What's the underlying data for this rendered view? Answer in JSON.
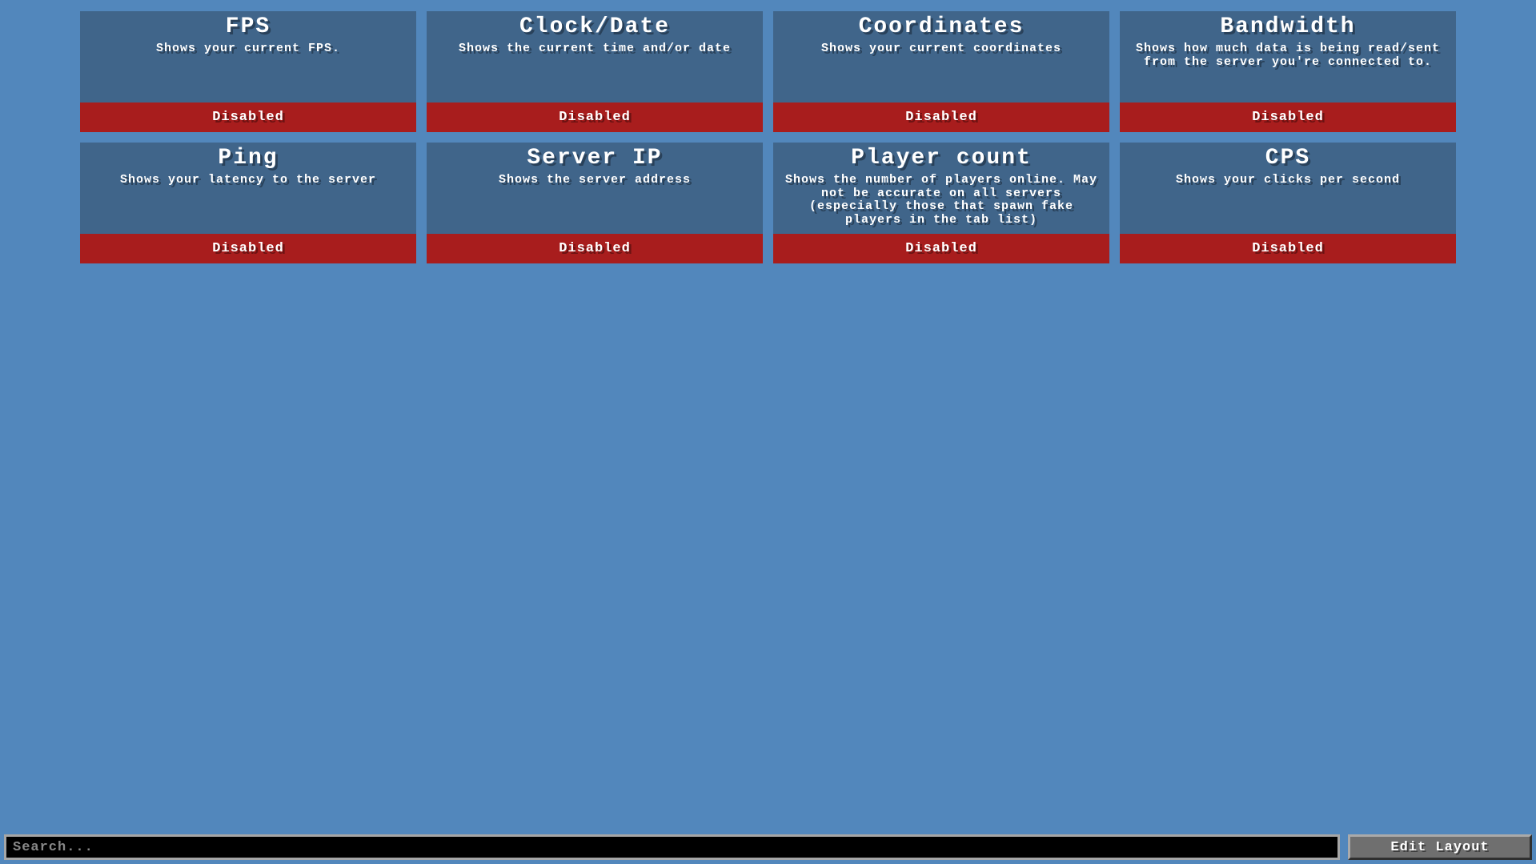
{
  "modules": [
    {
      "title": "FPS",
      "desc": "Shows your current FPS.",
      "status": "Disabled"
    },
    {
      "title": "Clock/Date",
      "desc": "Shows the current time and/or date",
      "status": "Disabled"
    },
    {
      "title": "Coordinates",
      "desc": "Shows your current coordinates",
      "status": "Disabled"
    },
    {
      "title": "Bandwidth",
      "desc": "Shows how much data is being read/sent from the server you're connected to.",
      "status": "Disabled"
    },
    {
      "title": "Ping",
      "desc": "Shows your latency to the server",
      "status": "Disabled"
    },
    {
      "title": "Server IP",
      "desc": "Shows the server address",
      "status": "Disabled"
    },
    {
      "title": "Player count",
      "desc": "Shows the number of players online. May not be accurate on all servers (especially those that spawn fake players in the tab list)",
      "status": "Disabled"
    },
    {
      "title": "CPS",
      "desc": "Shows your clicks per second",
      "status": "Disabled"
    }
  ],
  "search": {
    "placeholder": "Search...",
    "value": ""
  },
  "buttons": {
    "edit_layout": "Edit Layout"
  }
}
